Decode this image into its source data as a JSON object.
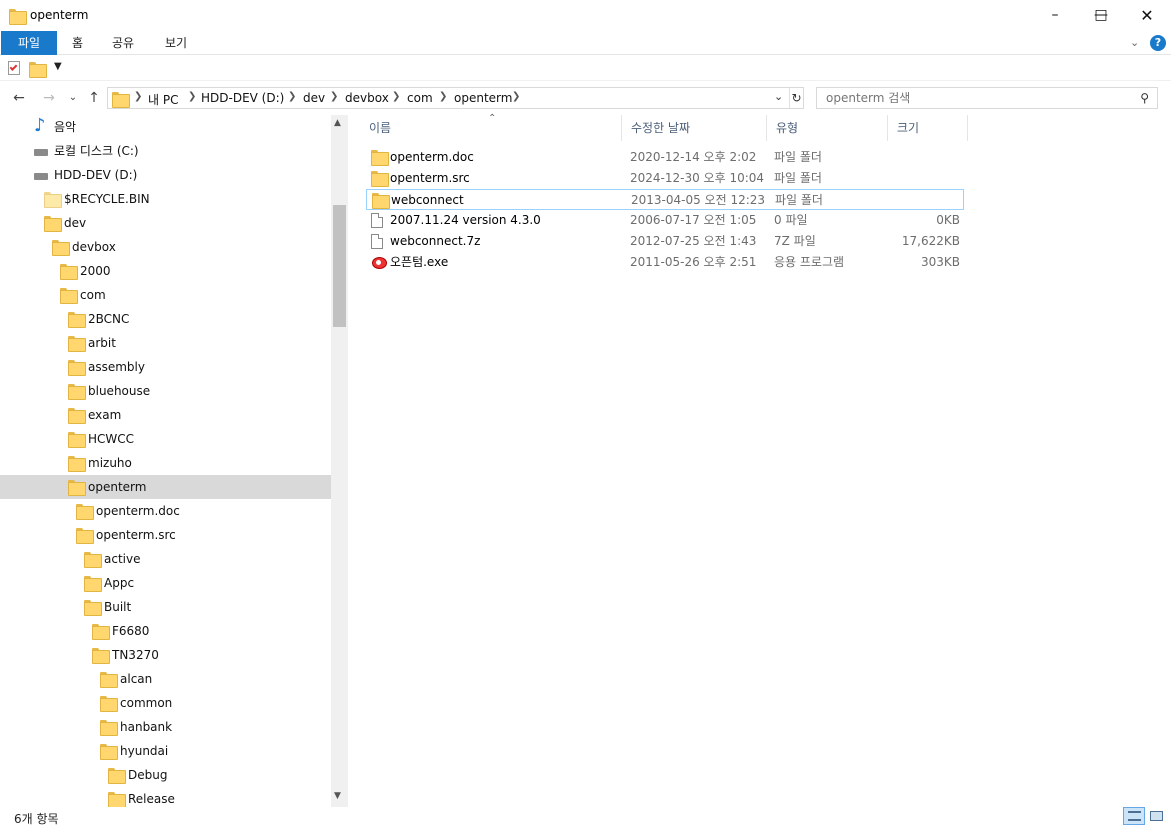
{
  "window": {
    "title": "openterm"
  },
  "ribbon": {
    "tabs": [
      "파일",
      "홈",
      "공유",
      "보기"
    ]
  },
  "address": {
    "crumbs": [
      "내 PC",
      "HDD-DEV (D:)",
      "dev",
      "devbox",
      "com",
      "openterm"
    ]
  },
  "search": {
    "placeholder": "openterm 검색"
  },
  "nav": {
    "items": [
      {
        "label": "음악",
        "icon": "music-note-icon",
        "indent": 0
      },
      {
        "label": "로컬 디스크 (C:)",
        "icon": "drive-icon",
        "indent": 0
      },
      {
        "label": "HDD-DEV (D:)",
        "icon": "drive-icon",
        "indent": 0
      },
      {
        "label": "$RECYCLE.BIN",
        "icon": "folder-icon",
        "indent": 1
      },
      {
        "label": "dev",
        "icon": "folder-icon",
        "indent": 1
      },
      {
        "label": "devbox",
        "icon": "folder-icon",
        "indent": 2
      },
      {
        "label": "2000",
        "icon": "folder-icon",
        "indent": 3
      },
      {
        "label": "com",
        "icon": "folder-icon",
        "indent": 3
      },
      {
        "label": "2BCNC",
        "icon": "folder-icon",
        "indent": 4
      },
      {
        "label": "arbit",
        "icon": "folder-icon",
        "indent": 4
      },
      {
        "label": "assembly",
        "icon": "folder-icon",
        "indent": 4
      },
      {
        "label": "bluehouse",
        "icon": "folder-icon",
        "indent": 4
      },
      {
        "label": "exam",
        "icon": "folder-icon",
        "indent": 4
      },
      {
        "label": "HCWCC",
        "icon": "folder-icon",
        "indent": 4
      },
      {
        "label": "mizuho",
        "icon": "folder-icon",
        "indent": 4
      },
      {
        "label": "openterm",
        "icon": "folder-icon",
        "indent": 4,
        "selected": true
      },
      {
        "label": "openterm.doc",
        "icon": "folder-icon",
        "indent": 5
      },
      {
        "label": "openterm.src",
        "icon": "folder-icon",
        "indent": 5
      },
      {
        "label": "active",
        "icon": "folder-icon",
        "indent": 6
      },
      {
        "label": "Appc",
        "icon": "folder-icon",
        "indent": 6
      },
      {
        "label": "Built",
        "icon": "folder-icon",
        "indent": 6
      },
      {
        "label": "F6680",
        "icon": "folder-icon",
        "indent": 7
      },
      {
        "label": "TN3270",
        "icon": "folder-icon",
        "indent": 7
      },
      {
        "label": "alcan",
        "icon": "folder-icon",
        "indent": 8
      },
      {
        "label": "common",
        "icon": "folder-icon",
        "indent": 8
      },
      {
        "label": "hanbank",
        "icon": "folder-icon",
        "indent": 8
      },
      {
        "label": "hyundai",
        "icon": "folder-icon",
        "indent": 8
      },
      {
        "label": "Debug",
        "icon": "folder-icon",
        "indent": 9
      },
      {
        "label": "Release",
        "icon": "folder-icon",
        "indent": 9
      }
    ]
  },
  "columns": {
    "name": "이름",
    "date": "수정한 날짜",
    "type": "유형",
    "size": "크기"
  },
  "files": [
    {
      "name": "openterm.doc",
      "date": "2020-12-14 오후 2:02",
      "type": "파일 폴더",
      "size": "",
      "icon": "folder"
    },
    {
      "name": "openterm.src",
      "date": "2024-12-30 오후 10:04",
      "type": "파일 폴더",
      "size": "",
      "icon": "folder"
    },
    {
      "name": "webconnect",
      "date": "2013-04-05 오전 12:23",
      "type": "파일 폴더",
      "size": "",
      "icon": "folder",
      "selected": true
    },
    {
      "name": "2007.11.24 version 4.3.0",
      "date": "2006-07-17 오전 1:05",
      "type": "0 파일",
      "size": "0KB",
      "icon": "file"
    },
    {
      "name": "webconnect.7z",
      "date": "2012-07-25 오전 1:43",
      "type": "7Z 파일",
      "size": "17,622KB",
      "icon": "file"
    },
    {
      "name": "오픈텀.exe",
      "date": "2011-05-26 오후 2:51",
      "type": "응용 프로그램",
      "size": "303KB",
      "icon": "exe"
    }
  ],
  "status": {
    "text": "6개 항목"
  },
  "colors": {
    "accent": "#1979ca",
    "selected_row": "#d9d9d9",
    "header_text": "#4c607a"
  }
}
